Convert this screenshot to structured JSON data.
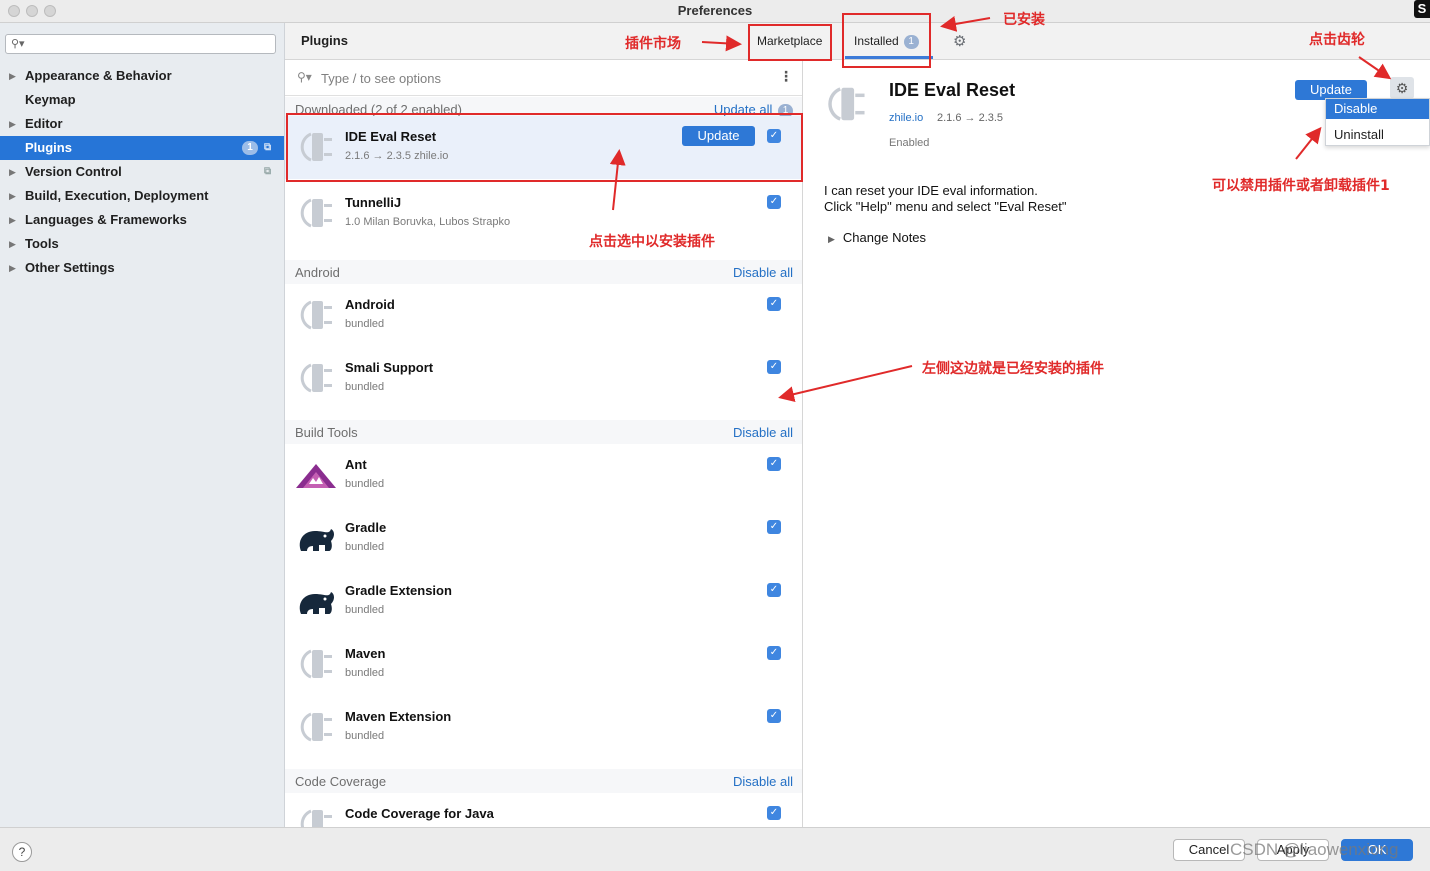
{
  "window": {
    "title": "Preferences"
  },
  "sidebar": {
    "search_placeholder": "",
    "items": [
      {
        "label": "Appearance & Behavior",
        "arrow": "▶"
      },
      {
        "label": "Keymap",
        "arrow": ""
      },
      {
        "label": "Editor",
        "arrow": "▶"
      },
      {
        "label": "Plugins",
        "arrow": "",
        "badge": "1",
        "selected": true
      },
      {
        "label": "Version Control",
        "arrow": "▶"
      },
      {
        "label": "Build, Execution, Deployment",
        "arrow": "▶"
      },
      {
        "label": "Languages & Frameworks",
        "arrow": "▶"
      },
      {
        "label": "Tools",
        "arrow": "▶"
      },
      {
        "label": "Other Settings",
        "arrow": "▶"
      }
    ]
  },
  "header": {
    "title": "Plugins",
    "tabs": [
      {
        "label": "Marketplace"
      },
      {
        "label": "Installed",
        "badge": "1",
        "active": true
      }
    ]
  },
  "list": {
    "search_placeholder": "Type / to see options",
    "groups": [
      {
        "name": "Downloaded (2 of 2 enabled)",
        "action": "Update all",
        "action_badge": "1",
        "plugins": [
          {
            "name": "IDE Eval Reset",
            "meta": "2.1.6 → 2.3.5  zhile.io",
            "update_label": "Update",
            "checked": true,
            "icon": "plug"
          },
          {
            "name": "TunnelliJ",
            "meta": "1.0  Milan Boruvka, Lubos Strapko",
            "checked": true,
            "icon": "plug"
          }
        ]
      },
      {
        "name": "Android",
        "action": "Disable all",
        "plugins": [
          {
            "name": "Android",
            "meta": "bundled",
            "checked": true,
            "icon": "plug"
          },
          {
            "name": "Smali Support",
            "meta": "bundled",
            "checked": true,
            "icon": "plug"
          }
        ]
      },
      {
        "name": "Build Tools",
        "action": "Disable all",
        "plugins": [
          {
            "name": "Ant",
            "meta": "bundled",
            "checked": true,
            "icon": "ant"
          },
          {
            "name": "Gradle",
            "meta": "bundled",
            "checked": true,
            "icon": "elephant"
          },
          {
            "name": "Gradle Extension",
            "meta": "bundled",
            "checked": true,
            "icon": "elephant"
          },
          {
            "name": "Maven",
            "meta": "bundled",
            "checked": true,
            "icon": "plug"
          },
          {
            "name": "Maven Extension",
            "meta": "bundled",
            "checked": true,
            "icon": "plug"
          }
        ]
      },
      {
        "name": "Code Coverage",
        "action": "Disable all",
        "plugins": [
          {
            "name": "Code Coverage for Java",
            "meta": "",
            "checked": true,
            "icon": "plug"
          }
        ]
      }
    ]
  },
  "detail": {
    "title": "IDE Eval Reset",
    "vendor": "zhile.io",
    "version": "2.1.6 → 2.3.5",
    "status": "Enabled",
    "update_label": "Update",
    "description_line1": "I can reset your IDE eval information.",
    "description_line2": "Click \"Help\" menu and select \"Eval Reset\"",
    "change_notes": "Change Notes",
    "menu": [
      {
        "label": "Disable",
        "highlighted": true
      },
      {
        "label": "Uninstall"
      }
    ]
  },
  "footer": {
    "help": "?",
    "cancel": "Cancel",
    "apply": "Apply",
    "ok": "OK",
    "watermark": "CSDN @liaowenxiong"
  },
  "annotations": {
    "marketplace_note": "插件市场",
    "installed_note": "已安装",
    "gear_note": "点击齿轮",
    "install_note": "点击选中以安装插件",
    "menu_note": "可以禁用插件或者卸载插件1",
    "list_note": "左侧这边就是已经安装的插件"
  },
  "colors": {
    "accent": "#2e78d6",
    "selection": "#2675d7",
    "annotation": "#e02a2a",
    "link": "#2470c5"
  }
}
